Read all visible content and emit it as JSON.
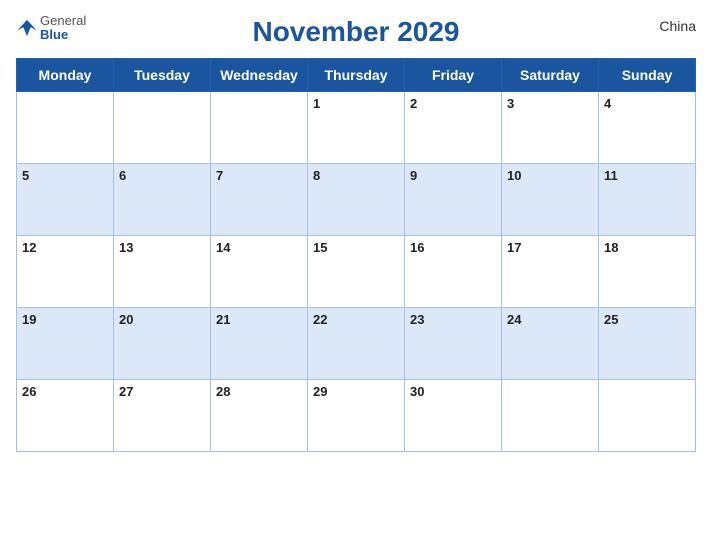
{
  "header": {
    "logo_general": "General",
    "logo_blue": "Blue",
    "title": "November 2029",
    "country": "China"
  },
  "weekdays": [
    "Monday",
    "Tuesday",
    "Wednesday",
    "Thursday",
    "Friday",
    "Saturday",
    "Sunday"
  ],
  "weeks": [
    [
      null,
      null,
      null,
      1,
      2,
      3,
      4
    ],
    [
      5,
      6,
      7,
      8,
      9,
      10,
      11
    ],
    [
      12,
      13,
      14,
      15,
      16,
      17,
      18
    ],
    [
      19,
      20,
      21,
      22,
      23,
      24,
      25
    ],
    [
      26,
      27,
      28,
      29,
      30,
      null,
      null
    ]
  ]
}
